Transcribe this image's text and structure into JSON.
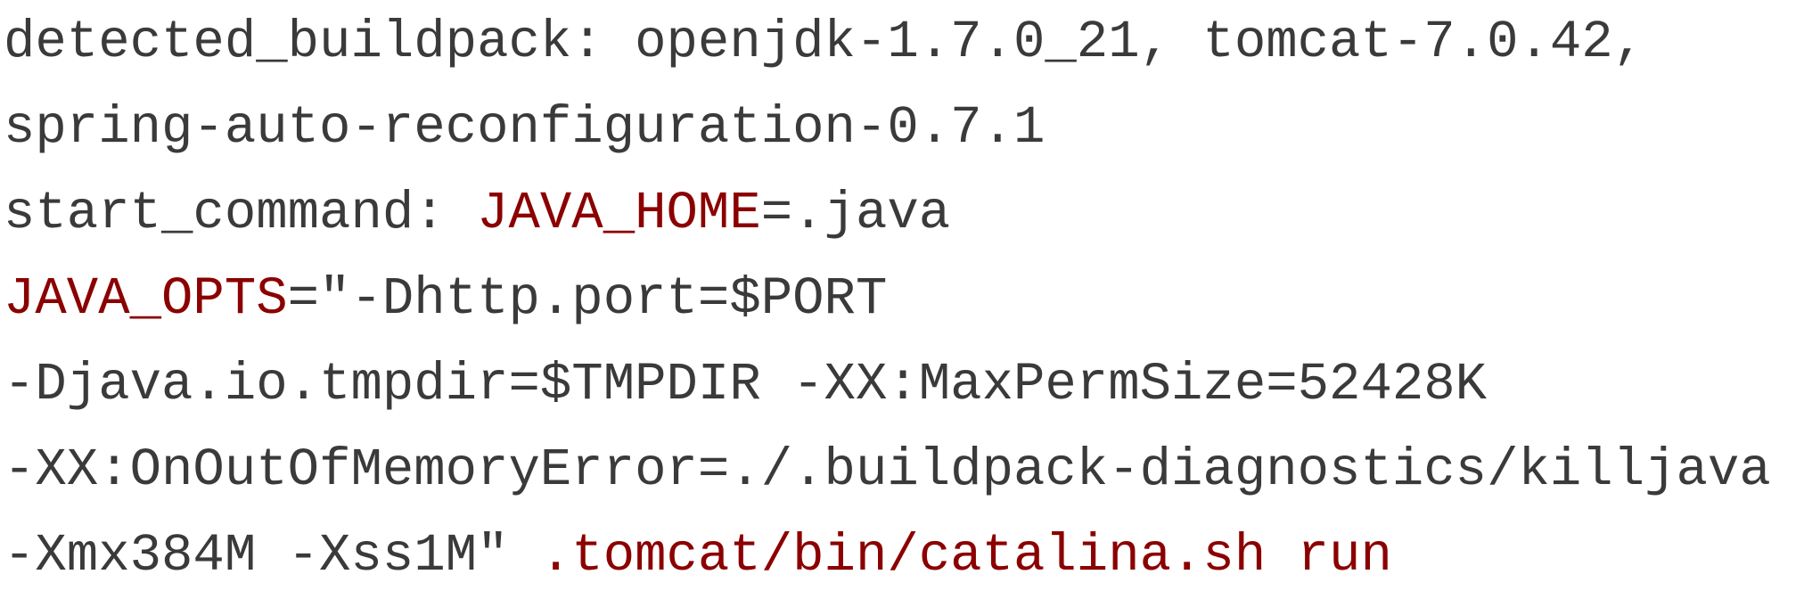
{
  "code": {
    "lines": [
      {
        "segments": [
          {
            "text": "detected_buildpack: openjdk-1.7.0_21, tomcat-7.0.42,",
            "kind": "default"
          }
        ]
      },
      {
        "segments": [
          {
            "text": "spring-auto-reconfiguration-0.7.1",
            "kind": "default"
          }
        ]
      },
      {
        "segments": [
          {
            "text": "start_command: ",
            "kind": "default"
          },
          {
            "text": "JAVA_HOME",
            "kind": "var"
          },
          {
            "text": "=.java",
            "kind": "default"
          }
        ]
      },
      {
        "segments": [
          {
            "text": "JAVA_OPTS",
            "kind": "var"
          },
          {
            "text": "=\"-Dhttp.port=$PORT",
            "kind": "default"
          }
        ]
      },
      {
        "segments": [
          {
            "text": "-Djava.io.tmpdir=$TMPDIR -XX:MaxPermSize=52428K",
            "kind": "default"
          }
        ]
      },
      {
        "segments": [
          {
            "text": "-XX:OnOutOfMemoryError=./.buildpack-diagnostics/killjava",
            "kind": "default"
          }
        ]
      },
      {
        "segments": [
          {
            "text": "-Xmx384M -Xss1M\" ",
            "kind": "default"
          },
          {
            "text": ".tomcat/bin/catalina.sh run",
            "kind": "path"
          }
        ]
      }
    ]
  },
  "colors": {
    "text": "#3a3a3a",
    "highlight": "#8b0000",
    "background": "#ffffff"
  }
}
